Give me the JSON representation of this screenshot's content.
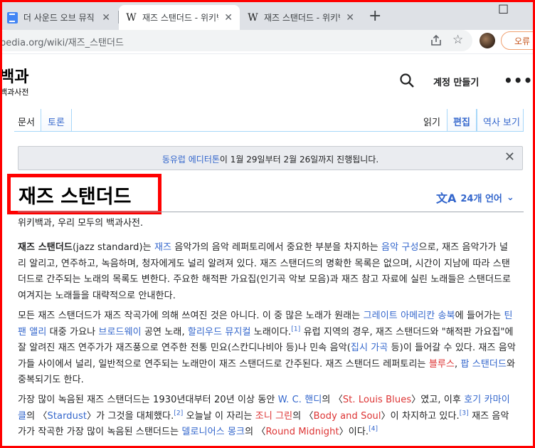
{
  "browser": {
    "tabs": [
      {
        "title": "더 사운드 오브 뮤직",
        "close": "✕",
        "icon": "docs-icon"
      },
      {
        "title": "재즈 스탠더드 - 위키백과",
        "close": "✕",
        "icon": "wikipedia-icon"
      },
      {
        "title": "재즈 스탠더드 - 위키백과",
        "close": "✕",
        "icon": "wikipedia-icon"
      }
    ],
    "new_tab": "+",
    "url": "pedia.org/wiki/재즈_스탠더드",
    "error_button": "오류",
    "window_controls": {
      "restore": "□"
    }
  },
  "wiki": {
    "wordmark": "백과",
    "tagline": "백과사전",
    "create_account": "계정 만들기",
    "more": "•••",
    "tabs": {
      "article": "문서",
      "talk": "토론",
      "read": "읽기",
      "edit": "편집",
      "history": "역사 보기"
    },
    "banner": {
      "link": "동유럽 에디터톤",
      "text": "이 1월 29일부터 2월 26일까지 진행됩니다.",
      "close": "✕"
    },
    "title": "재즈 스탠더드",
    "languages": "24개 언어",
    "lang_chevron": "⌄",
    "lang_icon": "文A",
    "from": "위키백과, 우리 모두의 백과사전."
  },
  "article": {
    "p1": {
      "bold": "재즈 스탠더드",
      "t1": "(jazz standard)는 ",
      "l1": "재즈",
      "t2": " 음악가의 음악 레퍼토리에서 중요한 부분을 차지하는 ",
      "l2": "음악 구성",
      "t3": "으로, 재즈 음악가가 널리 알리고, 연주하고, 녹음하며, 청자에게도 널리 알려져 있다. 재즈 스탠더드의 명확한 목록은 없으며, 시간이 지남에 따라 스탠더드로 간주되는 노래의 목록도 변한다. 주요한 해적판 가요집(인기곡 악보 모음)과 재즈 참고 자료에 실린 노래들은 스탠더드로 여겨지는 노래들을 대략적으로 안내한다."
    },
    "p2": {
      "t1": "모든 재즈 스탠더드가 재즈 작곡가에 의해 쓰여진 것은 아니다. 이 중 많은 노래가 원래는 ",
      "l1": "그레이트 아메리칸 송북",
      "t2": "에 들어가는 ",
      "l2": "틴 팬 앨리",
      "t3": " 대중 가요나 ",
      "l3": "브로드웨이",
      "t4": " 공연 노래, ",
      "l4": "할리우드 뮤지컬",
      "t5": " 노래이다.",
      "ref1": "[1]",
      "t6": " 유럽 지역의 경우, 재즈 스탠더드와 \"해적판 가요집\"에 잘 알려진 재즈 연주가가 재즈풍으로 연주한 전통 민요(스칸디나비아 등)나 민속 음악(",
      "l5": "집시 가곡",
      "t7": " 등)이 들어갈 수 있다. 재즈 음악가들 사이에서 널리, 일반적으로 연주되는 노래만이 재즈 스탠더드로 간주된다. 재즈 스탠더드 레퍼토리는 ",
      "l6": "블루스",
      "t8": ", ",
      "l7": "팝 스탠더드",
      "t9": "와 중복되기도 한다."
    },
    "p3": {
      "t1": "가장 많이 녹음된 재즈 스탠더드는 1930년대부터 20년 이상 동안 ",
      "l1": "W. C. 핸디",
      "t2": "의 〈",
      "l2": "St. Louis Blues",
      "t3": "〉였고, 이후 ",
      "l3": "호기 카마이클",
      "t4": "의 〈",
      "l4": "Stardust",
      "t5": "〉가 그것을 대체했다.",
      "ref2": "[2]",
      "t6": " 오늘날 이 자리는 ",
      "l5": "조니 그린",
      "t7": "의 〈",
      "l6": "Body and Soul",
      "t8": "〉이 차지하고 있다.",
      "ref3": "[3]",
      "t9": " 재즈 음악가가 작곡한 가장 많이 녹음된 스탠더드는 ",
      "l7": "델로니어스 몽크",
      "t10": "의 〈",
      "l8": "Round Midnight",
      "t11": "〉이다.",
      "ref4": "[4]"
    }
  }
}
